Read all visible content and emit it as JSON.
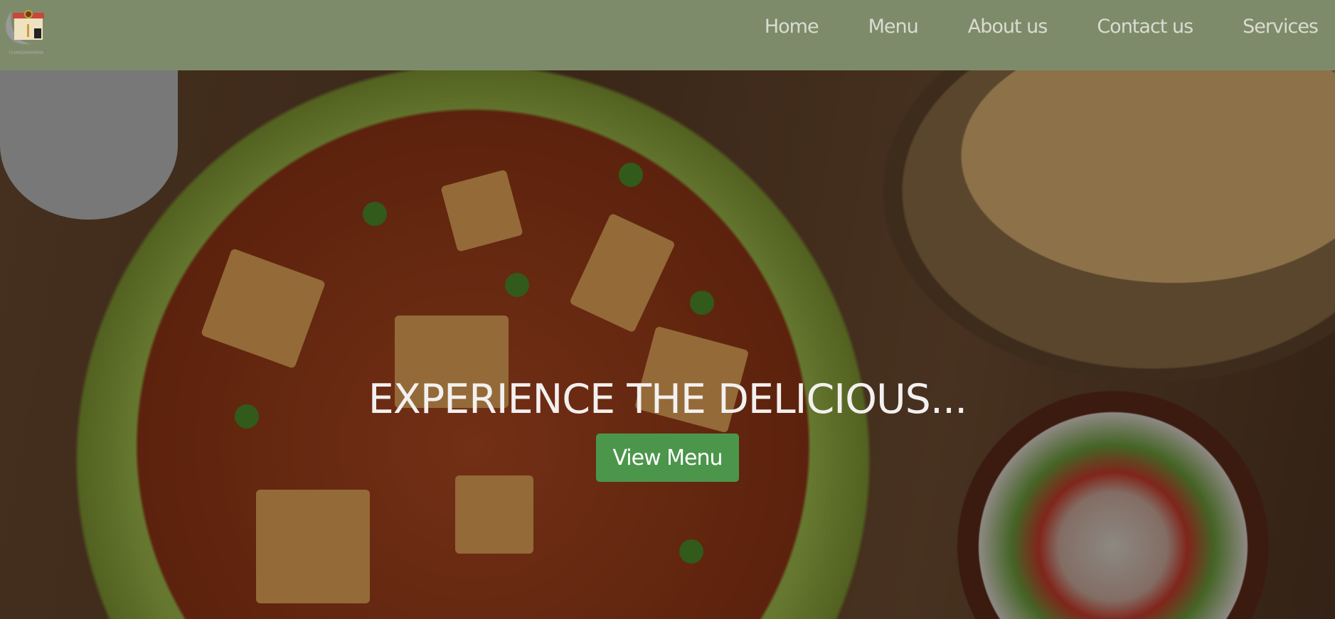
{
  "brand": {
    "logo_text": "CHANDRAMAMA"
  },
  "nav": {
    "items": [
      "Home",
      "Menu",
      "About us",
      "Contact us",
      "Services"
    ]
  },
  "hero": {
    "headline": "EXPERIENCE THE DELICIOUS...",
    "cta": "View Menu"
  },
  "colors": {
    "nav_bg": "#7e8b6a",
    "nav_text": "#d9dcd2",
    "cta_bg": "#4c964b"
  }
}
